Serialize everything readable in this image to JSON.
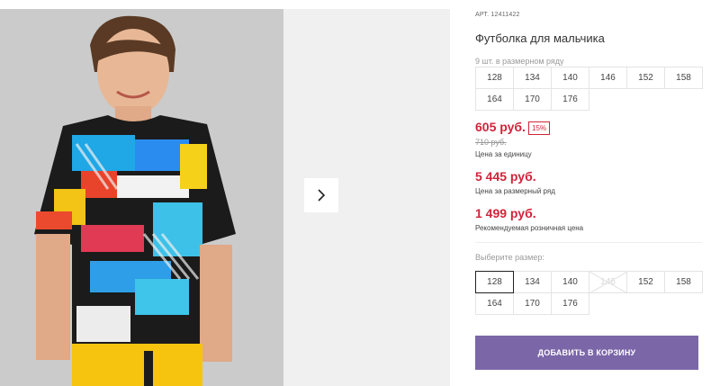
{
  "product": {
    "article": "АРТ. 12411422",
    "title": "Футболка для мальчика",
    "pack_note": "9 шт. в размерном ряду"
  },
  "sizes_info": [
    "128",
    "134",
    "140",
    "146",
    "152",
    "158",
    "164",
    "170",
    "176"
  ],
  "prices": {
    "price": "605 руб.",
    "discount": "15%",
    "old_price": "710 руб.",
    "unit_label": "Цена за единицу",
    "row_price": "5 445 руб.",
    "row_label": "Цена за размерный ряд",
    "rrp": "1 499 руб.",
    "rrp_label": "Рекомендуемая розничная цена"
  },
  "size_select": {
    "label": "Выберите размер:",
    "options": [
      "128",
      "134",
      "140",
      "146",
      "152",
      "158",
      "164",
      "170",
      "176"
    ],
    "selected": "128",
    "unavailable": [
      "146"
    ]
  },
  "actions": {
    "add_to_cart": "ДОБАВИТЬ В КОРЗИНУ"
  },
  "colors": {
    "price_red": "#d0243a",
    "cart_button": "#7b66a8"
  }
}
